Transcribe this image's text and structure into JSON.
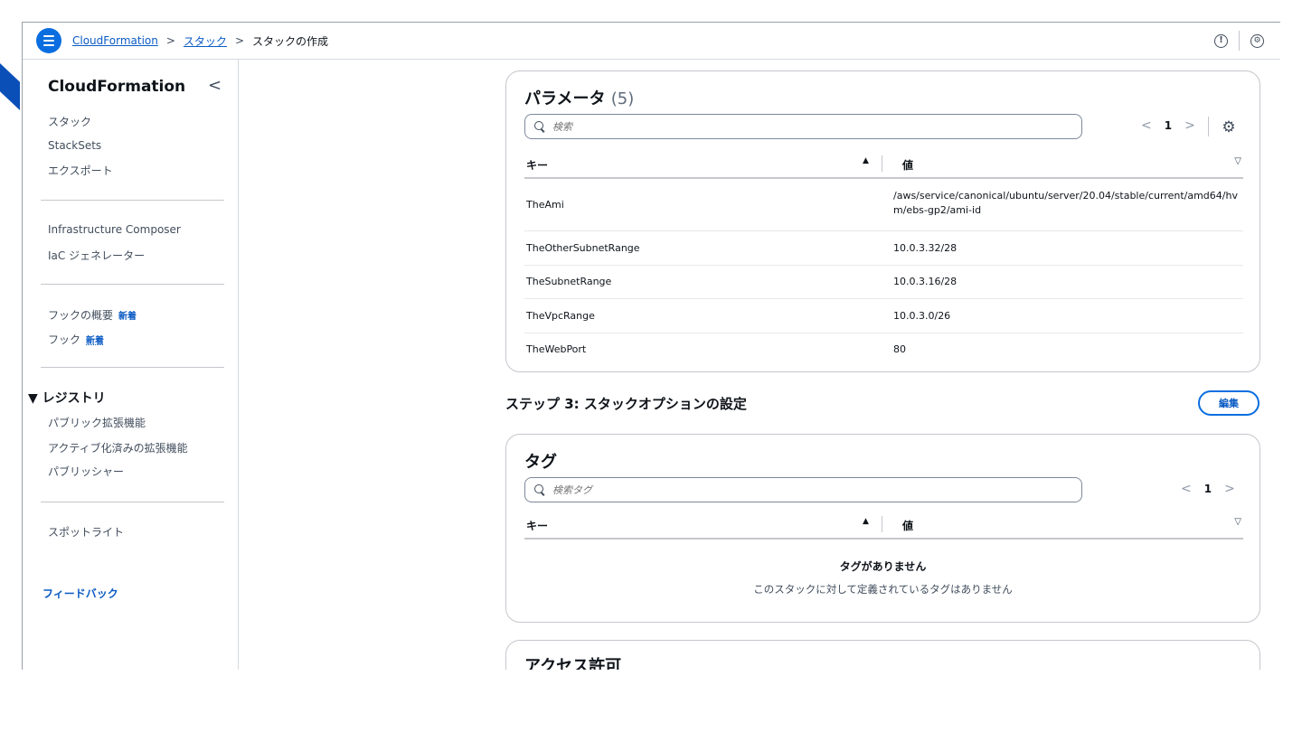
{
  "header": {
    "breadcrumbs": [
      "CloudFormation",
      "スタック",
      "スタックの作成"
    ],
    "separator": ">",
    "info_icon": "info-icon",
    "settings_icon": "settings-icon"
  },
  "sidebar": {
    "title": "CloudFormation",
    "collapse": "<",
    "group1": [
      "スタック",
      "StackSets",
      "エクスポート"
    ],
    "group2": [
      "Infrastructure Composer",
      "IaC ジェネレーター"
    ],
    "hooks_overview": "フックの概要",
    "hooks": "フック",
    "new_badge": "新着",
    "registry_section": "▼ レジストリ",
    "registry_items": [
      "パブリック拡張機能",
      "アクティブ化済みの拡張機能",
      "パブリッシャー"
    ],
    "spotlight": "スポットライト",
    "feedback": "フィードバック"
  },
  "parameters": {
    "title": "パラメータ",
    "count": "(5)",
    "search_placeholder": "検索",
    "page": "1",
    "col_key": "キー",
    "col_value": "値",
    "rows": [
      {
        "key": "TheAmi",
        "value": "/aws/service/canonical/ubuntu/server/20.04/stable/current/amd64/hvm/ebs-gp2/ami-id"
      },
      {
        "key": "TheOtherSubnetRange",
        "value": "10.0.3.32/28"
      },
      {
        "key": "TheSubnetRange",
        "value": "10.0.3.16/28"
      },
      {
        "key": "TheVpcRange",
        "value": "10.0.3.0/26"
      },
      {
        "key": "TheWebPort",
        "value": "80"
      }
    ]
  },
  "step3": {
    "title": "ステップ 3: スタックオプションの設定",
    "edit_label": "編集"
  },
  "tags": {
    "title": "タグ",
    "search_placeholder": "検索タグ",
    "page": "1",
    "col_key": "キー",
    "col_value": "値",
    "empty_title": "タグがありません",
    "empty_desc": "このスタックに対して定義されているタグはありません"
  },
  "permissions": {
    "title": "アクセス許可"
  },
  "colors": {
    "link": "#0a5bc4",
    "accent": "#0a6ee0",
    "border": "#c6c6cd"
  }
}
